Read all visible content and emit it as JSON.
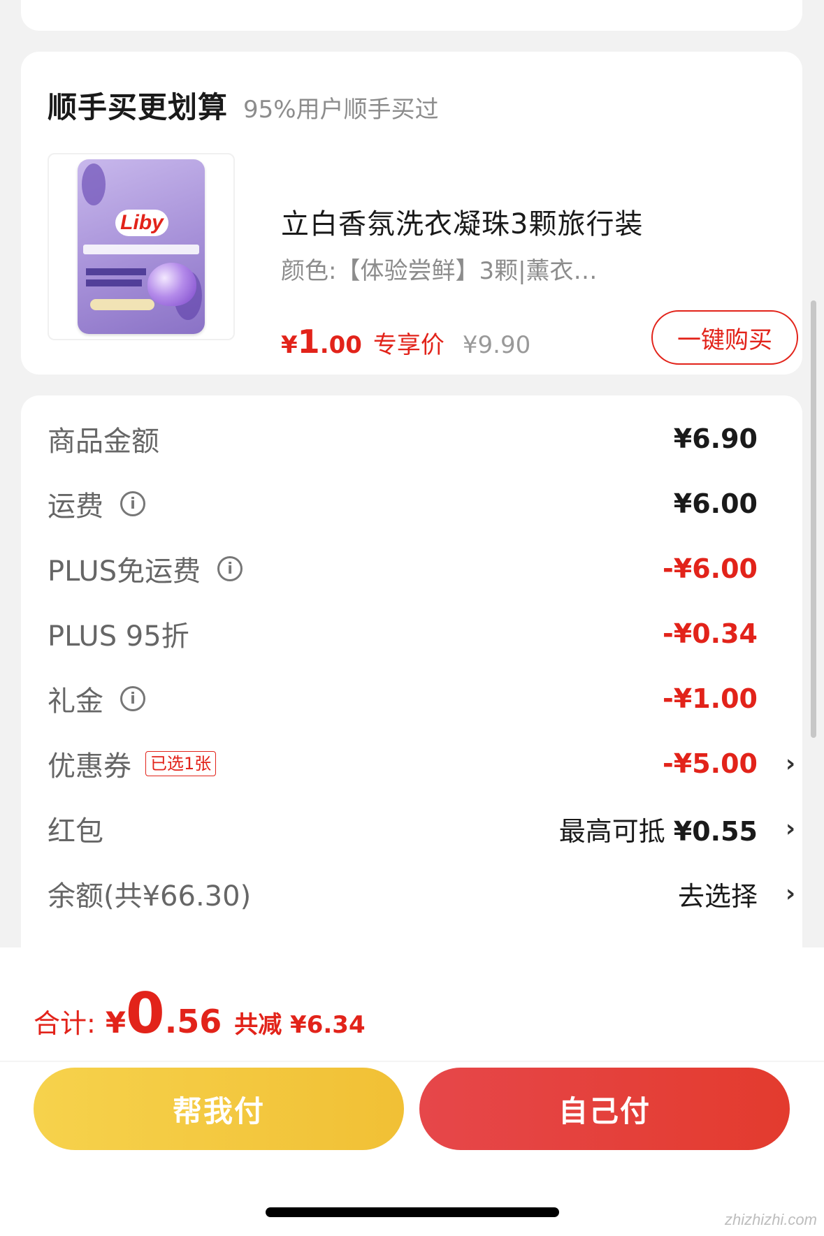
{
  "addon": {
    "title": "顺手买更划算",
    "subtitle": "95%用户顺手买过",
    "product": {
      "brand_logo": "Liby",
      "name": "立白香氛洗衣凝珠3颗旅行装",
      "spec": "颜色:【体验尝鲜】3颗|薰衣…",
      "price_yen": "¥",
      "price_int": "1",
      "price_dec": ".00",
      "price_tag": "专享价",
      "original_price": "¥9.90",
      "buy_button": "一键购买"
    }
  },
  "summary": {
    "rows": [
      {
        "label": "商品金额",
        "value": "¥6.90"
      },
      {
        "label": "运费",
        "value": "¥6.00"
      },
      {
        "label": "PLUS免运费",
        "value": "-¥6.00"
      },
      {
        "label": "PLUS 95折",
        "value": "-¥0.34"
      },
      {
        "label": "礼金",
        "value": "-¥1.00"
      },
      {
        "label": "优惠券",
        "tag": "已选1张",
        "value": "-¥5.00"
      },
      {
        "label": "红包",
        "value_prefix": "最高可抵",
        "value": "¥0.55"
      },
      {
        "label": "余额(共¥66.30)",
        "value": "去选择"
      }
    ],
    "info_icon": "i",
    "chevron": "›"
  },
  "footer": {
    "total_label": "合计:",
    "total_yen": "¥",
    "total_int": "0",
    "total_dec": ".56",
    "saved": "共减 ¥6.34",
    "help_pay": "帮我付",
    "self_pay": "自己付"
  },
  "watermark": "zhizhizhi.com",
  "colors": {
    "accent_red": "#e2231a",
    "help_pay_yellow": "#f3c83f",
    "self_pay_red": "#e43f3a"
  }
}
